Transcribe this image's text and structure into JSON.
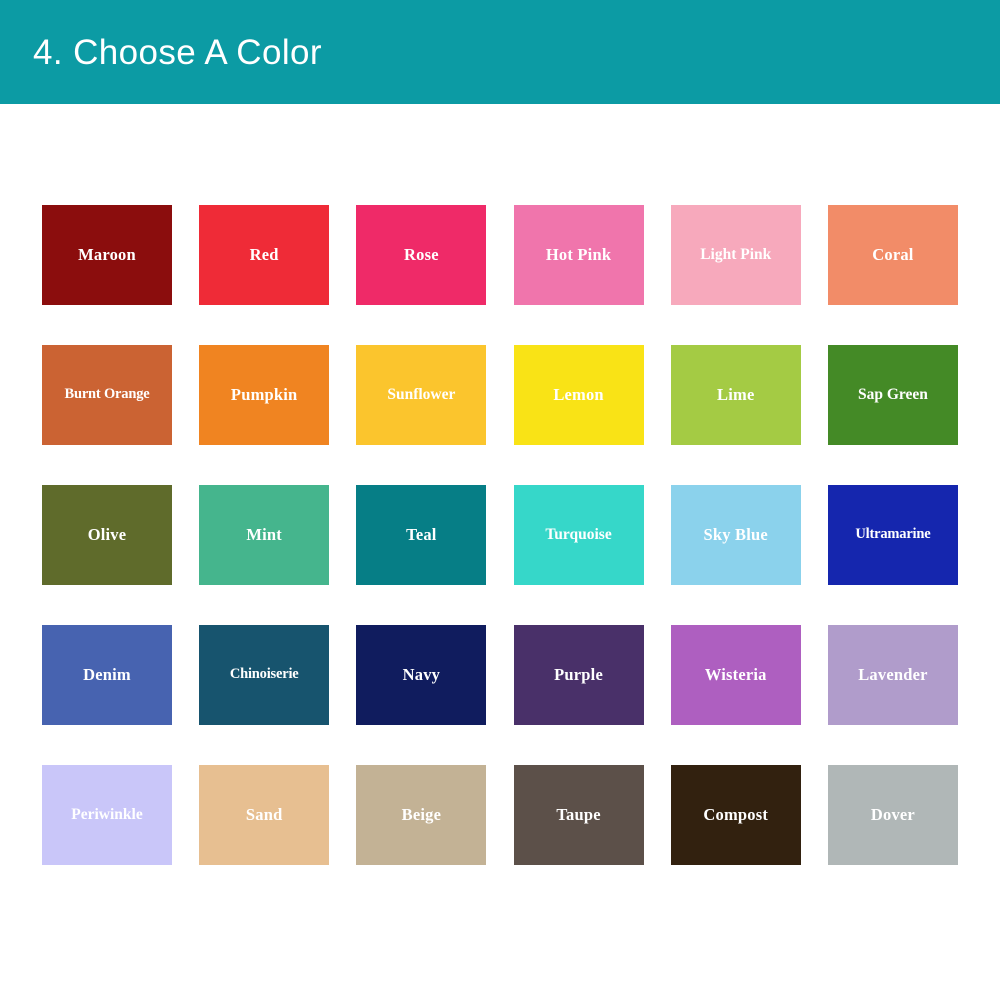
{
  "header": {
    "title": "4. Choose A Color",
    "background_color": "#0C9BA4",
    "text_color": "#FFFFFF"
  },
  "page": {
    "background_color": "#FFFFFF",
    "label_color": "#FFFFFF"
  },
  "grid": {
    "columns": 6,
    "rows": 5,
    "swatch_width": 130,
    "swatch_height": 100
  },
  "swatches": [
    {
      "label": "Maroon",
      "color": "#8B0D0D"
    },
    {
      "label": "Red",
      "color": "#EF2B37"
    },
    {
      "label": "Rose",
      "color": "#EF2A68"
    },
    {
      "label": "Hot Pink",
      "color": "#F075AC"
    },
    {
      "label": "Light Pink",
      "color": "#F7A9BC"
    },
    {
      "label": "Coral",
      "color": "#F28C68"
    },
    {
      "label": "Burnt Orange",
      "color": "#CB6333"
    },
    {
      "label": "Pumpkin",
      "color": "#F08421"
    },
    {
      "label": "Sunflower",
      "color": "#FBC52D"
    },
    {
      "label": "Lemon",
      "color": "#F9E316"
    },
    {
      "label": "Lime",
      "color": "#A4CB44"
    },
    {
      "label": "Sap Green",
      "color": "#448A26"
    },
    {
      "label": "Olive",
      "color": "#5F6B2B"
    },
    {
      "label": "Mint",
      "color": "#45B58D"
    },
    {
      "label": "Teal",
      "color": "#067E86"
    },
    {
      "label": "Turquoise",
      "color": "#36D7C9"
    },
    {
      "label": "Sky Blue",
      "color": "#8BD2EC"
    },
    {
      "label": "Ultramarine",
      "color": "#1526AE"
    },
    {
      "label": "Denim",
      "color": "#4763B0"
    },
    {
      "label": "Chinoiserie",
      "color": "#17546E"
    },
    {
      "label": "Navy",
      "color": "#101C5E"
    },
    {
      "label": "Purple",
      "color": "#493069"
    },
    {
      "label": "Wisteria",
      "color": "#AE5FC0"
    },
    {
      "label": "Lavender",
      "color": "#B09CCB"
    },
    {
      "label": "Periwinkle",
      "color": "#C9C6F9"
    },
    {
      "label": "Sand",
      "color": "#E7BF91"
    },
    {
      "label": "Beige",
      "color": "#C3B295"
    },
    {
      "label": "Taupe",
      "color": "#5C5049"
    },
    {
      "label": "Compost",
      "color": "#32210F"
    },
    {
      "label": "Dover",
      "color": "#B0B7B7"
    }
  ]
}
